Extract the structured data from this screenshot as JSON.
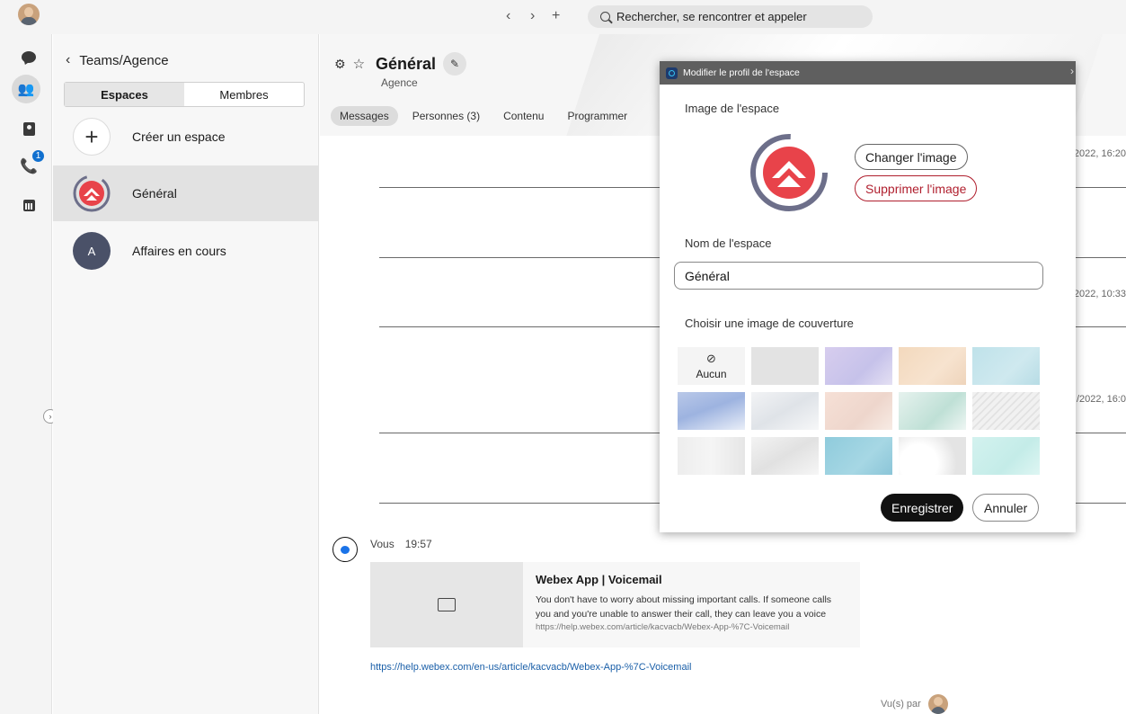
{
  "topbar": {
    "back": "‹",
    "forward": "›",
    "new": "+",
    "search_text": "Rechercher, se rencontrer et appeler"
  },
  "rail": {
    "calls_badge": "1",
    "collapse": "›"
  },
  "sidebar": {
    "breadcrumb": "Teams/Agence",
    "tabs": [
      "Espaces",
      "Membres"
    ],
    "create_label": "Créer un espace",
    "items": [
      {
        "label": "Général"
      },
      {
        "label": "Affaires en cours",
        "initial": "A"
      }
    ]
  },
  "space": {
    "title": "Général",
    "subtitle": "Agence",
    "tabs": [
      "Messages",
      "Personnes (3)",
      "Contenu",
      "Programmer"
    ]
  },
  "timeline": {
    "timestamps": [
      "2022, 16:20",
      "2022, 10:33",
      "/2022, 16:0"
    ]
  },
  "message": {
    "author": "Vous",
    "time": "19:57",
    "card_title": "Webex App | Voicemail",
    "card_desc": "You don't have to worry about missing important calls. If someone calls you and you're unable to answer their call, they can leave you a voice",
    "card_url": "https://help.webex.com/article/kacvacb/Webex-App-%7C-Voicemail",
    "link": "https://help.webex.com/en-us/article/kacvacb/Webex-App-%7C-Voicemail",
    "read_by": "Vu(s) par"
  },
  "modal": {
    "window_title": "Modifier le profil de l'espace",
    "close": "›",
    "image_label": "Image de l'espace",
    "change_image": "Changer l'image",
    "delete_image": "Supprimer l'image",
    "name_label": "Nom de l'espace",
    "name_value": "Général",
    "cover_label": "Choisir une image de couverture",
    "none_icon": "⊘",
    "none_label": "Aucun",
    "save": "Enregistrer",
    "cancel": "Annuler"
  },
  "colors": {
    "accent": "#1170cf",
    "danger": "#b01f2e",
    "logo_red": "#e8434a",
    "logo_ring": "#6d6f8a"
  }
}
